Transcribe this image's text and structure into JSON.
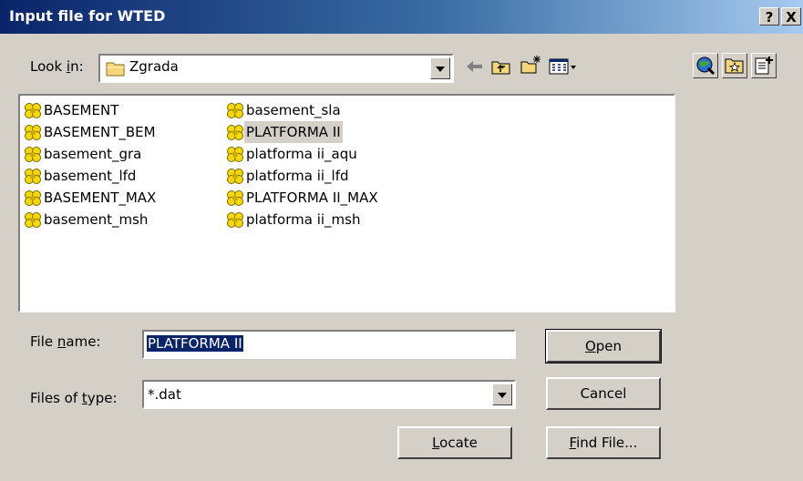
{
  "title": "Input file for WTED",
  "titlebar_buttons": {
    "help": "?",
    "close": "X"
  },
  "look_in": {
    "label_pre": "Look ",
    "label_key": "i",
    "label_post": "n:",
    "value": "Zgrada"
  },
  "toolbar_icons": [
    "back-arrow-icon",
    "up-one-level-icon",
    "create-new-folder-icon",
    "view-menu-icon"
  ],
  "right_icons": [
    "network-icon",
    "favorites-folder-icon",
    "properties-icon"
  ],
  "files": {
    "column1": [
      "BASEMENT",
      "BASEMENT_BEM",
      "basement_gra",
      "basement_lfd",
      "BASEMENT_MAX",
      "basement_msh"
    ],
    "column2": [
      "basement_sla",
      "PLATFORMA II",
      "platforma ii_aqu",
      "platforma ii_lfd",
      "PLATFORMA II_MAX",
      "platforma ii_msh"
    ],
    "selected": "PLATFORMA II"
  },
  "file_name": {
    "label_pre": "File ",
    "label_key": "n",
    "label_post": "ame:",
    "value": "PLATFORMA II"
  },
  "file_type": {
    "label_pre": "Files of ",
    "label_key": "t",
    "label_post": "ype:",
    "value": "*.dat"
  },
  "buttons": {
    "open": {
      "key": "O",
      "rest": "pen"
    },
    "cancel": "Cancel",
    "locate": {
      "key": "L",
      "rest": "ocate"
    },
    "find": {
      "key": "F",
      "rest": "ind File..."
    }
  },
  "colors": {
    "title_start": "#0a246a",
    "title_end": "#a6caf0",
    "face": "#d4d0c8",
    "selection": "#0a246a",
    "folder": "#f3d77a",
    "file_icon": "#f5d800"
  }
}
